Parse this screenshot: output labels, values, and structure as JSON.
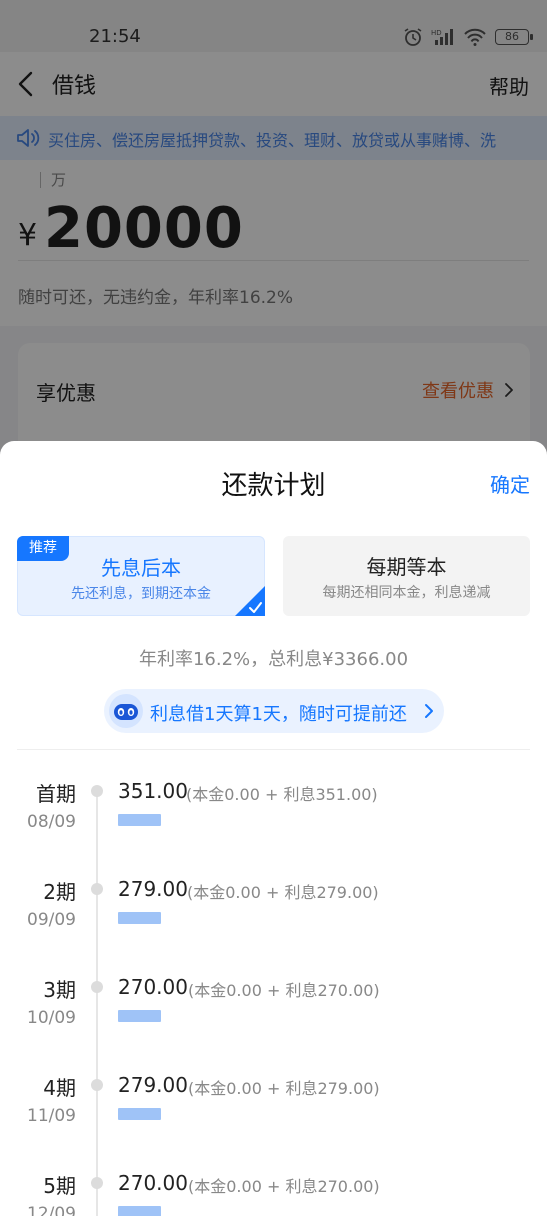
{
  "status": {
    "time": "21:54",
    "battery": "86"
  },
  "nav": {
    "title": "借钱",
    "help": "帮助"
  },
  "notice": {
    "text": "买住房、偿还房屋抵押贷款、投资、理财、放贷或从事赌博、洗"
  },
  "amount": {
    "unit_hint": "万",
    "currency": "¥",
    "value": "20000",
    "desc": "随时可还，无违约金，年利率16.2%"
  },
  "coupon": {
    "title": "享优惠",
    "link": "查看优惠"
  },
  "sheet": {
    "title": "还款计划",
    "confirm": "确定",
    "plans": [
      {
        "badge": "推荐",
        "name": "先息后本",
        "desc": "先还利息，到期还本金",
        "selected": true
      },
      {
        "name": "每期等本",
        "desc": "每期还相同本金，利息递减",
        "selected": false
      }
    ],
    "rate_summary": "年利率16.2%，总利息¥3366.00",
    "promo": "利息借1天算1天，随时可提前还",
    "schedule": [
      {
        "label": "首期",
        "date": "08/09",
        "amount": "351.00",
        "detail": "(本金0.00 + 利息351.00)",
        "interest_fraction": 1.0
      },
      {
        "label": "2期",
        "date": "09/09",
        "amount": "279.00",
        "detail": "(本金0.00 + 利息279.00)",
        "interest_fraction": 1.0
      },
      {
        "label": "3期",
        "date": "10/09",
        "amount": "270.00",
        "detail": "(本金0.00 + 利息270.00)",
        "interest_fraction": 1.0
      },
      {
        "label": "4期",
        "date": "11/09",
        "amount": "279.00",
        "detail": "(本金0.00 + 利息279.00)",
        "interest_fraction": 1.0
      },
      {
        "label": "5期",
        "date": "12/09",
        "amount": "270.00",
        "detail": "(本金0.00 + 利息270.00)",
        "interest_fraction": 1.0
      }
    ]
  },
  "colors": {
    "accent": "#1677ff",
    "link_orange": "#e8662a",
    "bar": "#9fc3f7"
  }
}
